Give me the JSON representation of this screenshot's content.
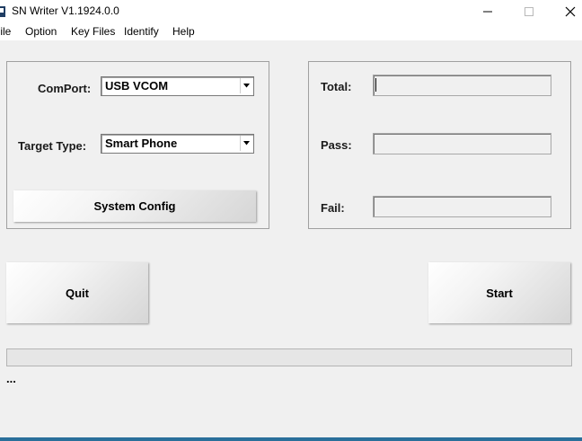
{
  "window": {
    "title": "SN Writer V1.1924.0.0",
    "accent_color": "#2a6f9a"
  },
  "menu": [
    "File",
    "Option",
    "Key Files",
    "Identify",
    "Help"
  ],
  "settings": {
    "comport_label": "ComPort:",
    "comport_value": "USB VCOM",
    "target_label": "Target Type:",
    "target_value": "Smart Phone",
    "system_config_label": "System Config"
  },
  "stats": {
    "total_label": "Total:",
    "total_value": "",
    "pass_label": "Pass:",
    "pass_value": "",
    "fail_label": "Fail:",
    "fail_value": ""
  },
  "actions": {
    "quit_label": "Quit",
    "start_label": "Start"
  },
  "progress": {
    "value": 0
  },
  "status_text": "..."
}
